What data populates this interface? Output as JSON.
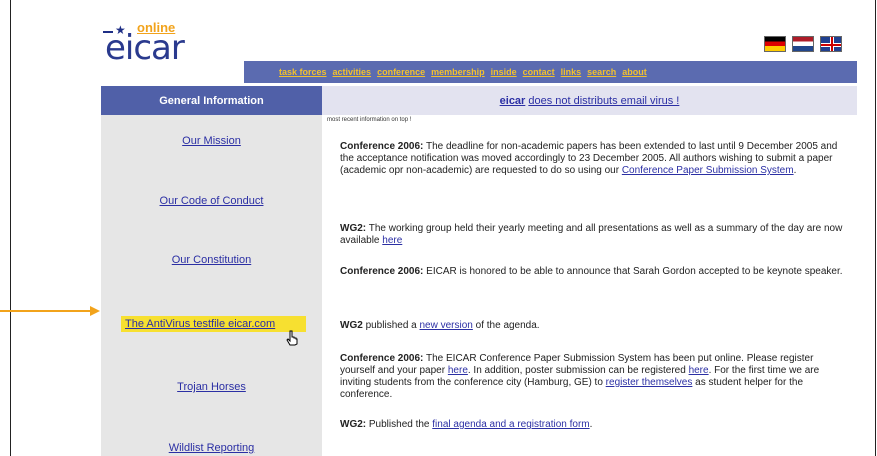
{
  "logo": {
    "online": "online",
    "brand": "eicar"
  },
  "nav": [
    "task forces",
    "activities",
    "conference",
    "membership",
    "inside",
    "contact",
    "links",
    "search",
    "about"
  ],
  "left": {
    "header": "General Information",
    "items": [
      {
        "label": "Our Mission"
      },
      {
        "label": "Our Code of Conduct"
      },
      {
        "label": "Our Constitution"
      },
      {
        "label": "The AntiVirus testfile eicar.com"
      },
      {
        "label": "Trojan Horses"
      },
      {
        "label": "Wildlist Reporting"
      }
    ]
  },
  "right": {
    "header_link": "eicar",
    "header_rest": "does not distributs email virus !",
    "recent": "most recent information on top !",
    "news": [
      {
        "title": "Conference 2006:",
        "text1": "The deadline for non-academic papers has been extended to last until 9 December 2005 and the acceptance notification was moved accordingly to 23 December 2005. All authors wishing to submit a paper (academic opr non-academic) are requested to do so using our",
        "link1": "Conference Paper Submission System",
        "text2": "."
      },
      {
        "title": "WG2:",
        "text1": "The working group held their yearly meeting and all presentations as well as a summary of the day are now available",
        "link1": "here",
        "text2": ""
      },
      {
        "title": "Conference 2006:",
        "text1": "EICAR is honored to be able to announce that Sarah Gordon accepted to be keynote speaker.",
        "link1": "",
        "text2": ""
      },
      {
        "title": "WG2",
        "text1": "published a",
        "link1": "new version",
        "text2": "of the agenda."
      },
      {
        "title": "Conference 2006:",
        "text1": "The EICAR Conference Paper Submission System has been put online. Please register yourself and your paper",
        "link1": "here",
        "text2": ". In addition, poster submission can be registered",
        "link2": "here",
        "text3": ". For the first time we are inviting students from the conference city (Hamburg, GE) to",
        "link3": "register themselves",
        "text4": "as student helper for the conference."
      },
      {
        "title": "WG2:",
        "text1": "Published the",
        "link1": "final agenda and a registration form",
        "text2": "."
      }
    ]
  },
  "colors": {
    "nav_bg": "#5b6bb0",
    "nav_link": "#f2c12e",
    "highlight": "#f7e030",
    "arrow": "#f2a31b"
  }
}
